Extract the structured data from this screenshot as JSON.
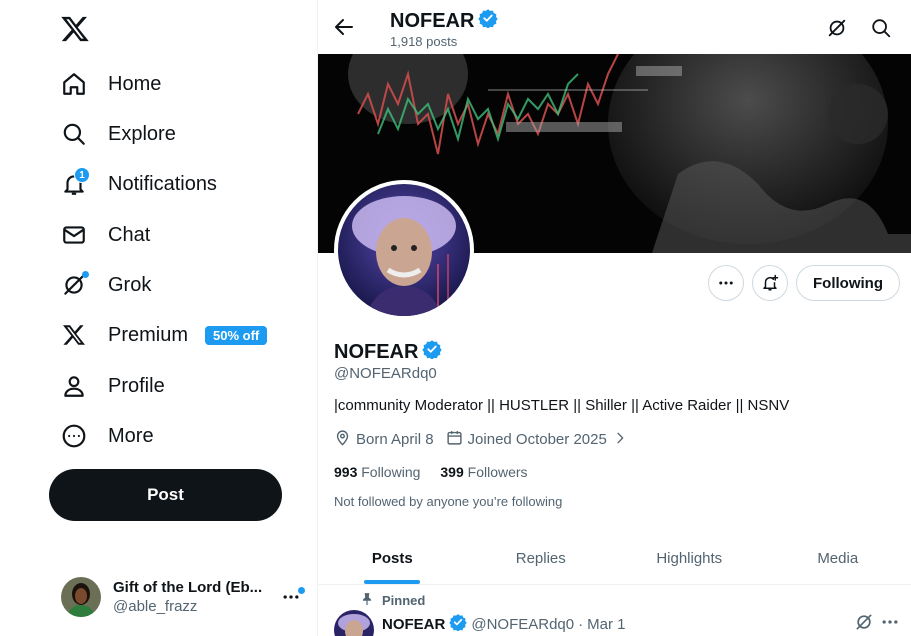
{
  "colors": {
    "accent": "#1d9bf0",
    "text": "#0f1419",
    "muted": "#536471",
    "border": "#cfd9de"
  },
  "sidebar": {
    "logo_icon": "x-logo-icon",
    "items": [
      {
        "label": "Home",
        "icon": "home-icon"
      },
      {
        "label": "Explore",
        "icon": "search-icon"
      },
      {
        "label": "Notifications",
        "icon": "bell-icon",
        "badge": "1"
      },
      {
        "label": "Chat",
        "icon": "mail-icon"
      },
      {
        "label": "Grok",
        "icon": "grok-icon"
      },
      {
        "label": "Premium",
        "icon": "x-logo-icon",
        "promo": "50% off"
      },
      {
        "label": "Profile",
        "icon": "person-icon"
      },
      {
        "label": "More",
        "icon": "more-circle-icon"
      }
    ],
    "post_button": "Post",
    "account": {
      "name": "Gift of the Lord (Eb...",
      "handle": "@able_frazz"
    }
  },
  "header": {
    "name": "NOFEAR",
    "posts": "1,918 posts"
  },
  "profile": {
    "name": "NOFEAR",
    "handle": "@NOFEARdq0",
    "bio": "|community Moderator || HUSTLER || Shiller || Active Raider || NSNV",
    "born": "Born April 8",
    "joined": "Joined October 2025",
    "following_count": "993",
    "following_label": "Following",
    "followers_count": "399",
    "followers_label": "Followers",
    "followed_by": "Not followed by anyone you’re following",
    "follow_button": "Following"
  },
  "tabs": [
    {
      "label": "Posts",
      "active": true
    },
    {
      "label": "Replies"
    },
    {
      "label": "Highlights"
    },
    {
      "label": "Media"
    }
  ],
  "pinned_post": {
    "pinned_label": "Pinned",
    "name": "NOFEAR",
    "handle": "@NOFEARdq0",
    "separator": "·",
    "date": "Mar 1"
  }
}
